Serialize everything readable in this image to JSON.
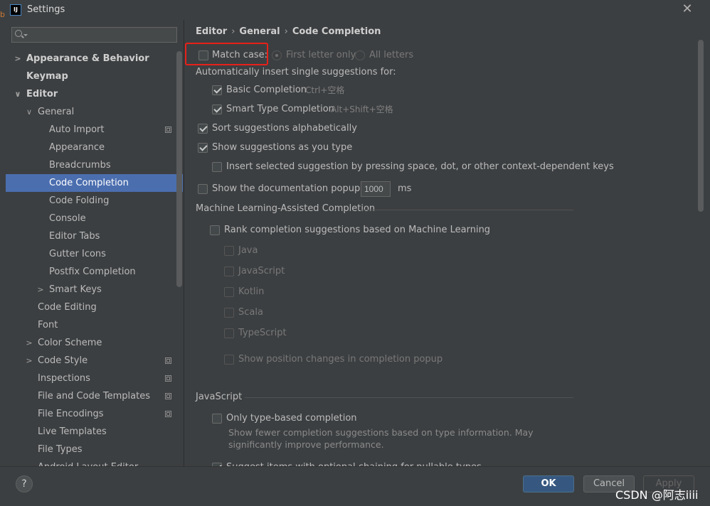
{
  "window": {
    "title": "Settings"
  },
  "sidebar": {
    "search_placeholder": "",
    "items": [
      {
        "label": "Appearance & Behavior"
      },
      {
        "label": "Keymap"
      },
      {
        "label": "Editor"
      },
      {
        "label": "General"
      },
      {
        "label": "Auto Import"
      },
      {
        "label": "Appearance"
      },
      {
        "label": "Breadcrumbs"
      },
      {
        "label": "Code Completion"
      },
      {
        "label": "Code Folding"
      },
      {
        "label": "Console"
      },
      {
        "label": "Editor Tabs"
      },
      {
        "label": "Gutter Icons"
      },
      {
        "label": "Postfix Completion"
      },
      {
        "label": "Smart Keys"
      },
      {
        "label": "Code Editing"
      },
      {
        "label": "Font"
      },
      {
        "label": "Color Scheme"
      },
      {
        "label": "Code Style"
      },
      {
        "label": "Inspections"
      },
      {
        "label": "File and Code Templates"
      },
      {
        "label": "File Encodings"
      },
      {
        "label": "Live Templates"
      },
      {
        "label": "File Types"
      },
      {
        "label": "Android Layout Editor"
      }
    ]
  },
  "breadcrumb": [
    "Editor",
    "General",
    "Code Completion"
  ],
  "options": {
    "match_case": "Match case:",
    "first_letter_only": "First letter only",
    "all_letters": "All letters",
    "auto_insert_heading": "Automatically insert single suggestions for:",
    "basic_completion": "Basic Completion",
    "basic_completion_shortcut": "Ctrl+空格",
    "smart_type_completion": "Smart Type Completion",
    "smart_type_shortcut": "Alt+Shift+空格",
    "sort_alphabetically": "Sort suggestions alphabetically",
    "show_as_you_type": "Show suggestions as you type",
    "insert_by_space": "Insert selected suggestion by pressing space, dot, or other context-dependent keys",
    "show_doc_popup": "Show the documentation popup in",
    "doc_popup_delay": "1000",
    "doc_popup_unit": "ms"
  },
  "ml_section": {
    "title": "Machine Learning-Assisted Completion",
    "rank": "Rank completion suggestions based on Machine Learning",
    "languages": [
      "Java",
      "JavaScript",
      "Kotlin",
      "Scala",
      "TypeScript"
    ],
    "show_position": "Show position changes in completion popup"
  },
  "js_section": {
    "title": "JavaScript",
    "type_based": "Only type-based completion",
    "type_based_desc_1": "Show fewer completion suggestions based on type information. May",
    "type_based_desc_2": "significantly improve performance.",
    "cut_off": "Suggest items with optional chaining for nullable types"
  },
  "footer": {
    "help": "?",
    "ok": "OK",
    "cancel": "Cancel",
    "apply": "Apply"
  },
  "watermark": "CSDN @阿志iiii",
  "colors": {
    "selection": "#4b6eaf",
    "highlight_box": "#e8201a",
    "ok_button": "#365880"
  }
}
